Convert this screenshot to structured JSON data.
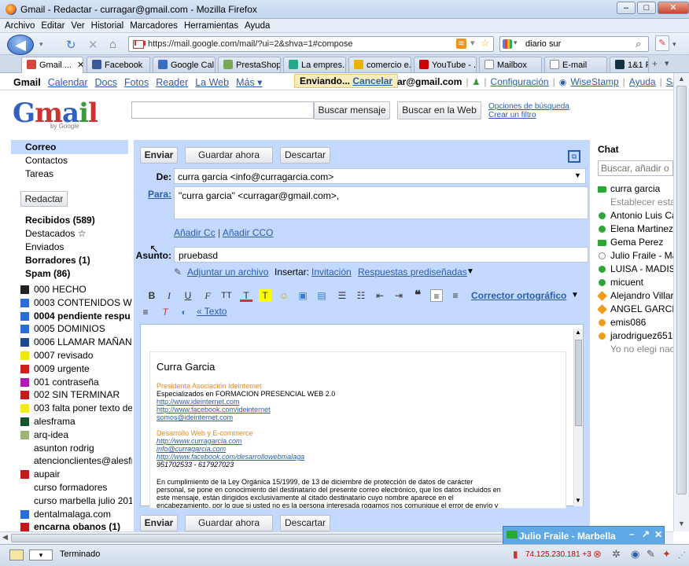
{
  "window": {
    "title": "Gmail - Redactar - curragar@gmail.com - Mozilla Firefox"
  },
  "menu": [
    "Archivo",
    "Editar",
    "Ver",
    "Historial",
    "Marcadores",
    "Herramientas",
    "Ayuda"
  ],
  "nav": {
    "url": "https://mail.google.com/mail/?ui=2&shva=1#compose",
    "search_value": "diario sur"
  },
  "tabs": [
    {
      "label": "Gmail ...",
      "color": "#d44638"
    },
    {
      "label": "Facebook",
      "color": "#3b5998"
    },
    {
      "label": "Google Cal...",
      "color": "#3a6ec4"
    },
    {
      "label": "PrestaShop...",
      "color": "#7a5"
    },
    {
      "label": "La empres...",
      "color": "#2a8"
    },
    {
      "label": "comercio e...",
      "color": "#e8b400"
    },
    {
      "label": "YouTube - ...",
      "color": "#c00"
    },
    {
      "label": "Mailbox",
      "color": "#888"
    },
    {
      "label": "E-mail",
      "color": "#888"
    },
    {
      "label": "1&1 Pa",
      "color": "#134"
    }
  ],
  "gbar": {
    "links": [
      "Gmail",
      "Calendar",
      "Docs",
      "Fotos",
      "Reader",
      "La Web",
      "Más ▾"
    ],
    "sending": "Enviando...",
    "cancel": "Cancelar",
    "account": "ar@gmail.com",
    "right_links": [
      "Configuración",
      "WiseStamp",
      "Ayuda",
      "Salir"
    ]
  },
  "search": {
    "btn_mail": "Buscar mensaje",
    "btn_web": "Buscar en la Web",
    "options": "Opciones de búsqueda",
    "filter": "Crear un filtro"
  },
  "logo": {
    "brand": "Gmail",
    "by": "by Google"
  },
  "leftnav": {
    "top": [
      "Correo",
      "Contactos",
      "Tareas"
    ],
    "compose": "Redactar",
    "folders": [
      {
        "label": "Recibidos (589)",
        "bold": true
      },
      {
        "label": "Destacados ☆",
        "bold": false
      },
      {
        "label": "Enviados",
        "bold": false
      },
      {
        "label": "Borradores (1)",
        "bold": true
      },
      {
        "label": "Spam (86)",
        "bold": true
      }
    ],
    "labels": [
      {
        "label": "000 HECHO",
        "color": "#222",
        "bold": false
      },
      {
        "label": "0003 CONTENIDOS WE",
        "color": "#2a6dd4",
        "bold": false
      },
      {
        "label": "0004 pendiente respu",
        "color": "#2a6dd4",
        "bold": true
      },
      {
        "label": "0005 DOMINIOS",
        "color": "#2a6dd4",
        "bold": false
      },
      {
        "label": "0006 LLAMAR MAÑANA",
        "color": "#1f4a8a",
        "bold": false
      },
      {
        "label": "0007 revisado",
        "color": "#f3e60a",
        "bold": false
      },
      {
        "label": "0009 urgente",
        "color": "#cc1f1f",
        "bold": false
      },
      {
        "label": "001 contraseña",
        "color": "#b418b4",
        "bold": false
      },
      {
        "label": "002 SIN TERMINAR",
        "color": "#c01c1c",
        "bold": false
      },
      {
        "label": "003 falta poner texto de",
        "color": "#f3ea1a",
        "bold": false
      },
      {
        "label": "alesframa",
        "color": "#14542a",
        "bold": false
      },
      {
        "label": "arq-idea",
        "color": "#9cb37a",
        "bold": false
      },
      {
        "label": "asunton rodrig",
        "color": "#ffffff",
        "bold": false
      },
      {
        "label": "atencionclientes@alesfr",
        "color": "#ffffff",
        "bold": false
      },
      {
        "label": "aupair",
        "color": "#c11a1a",
        "bold": false
      },
      {
        "label": "curso formadores",
        "color": "#ffffff",
        "bold": false
      },
      {
        "label": "curso marbella julio 201",
        "color": "#ffffff",
        "bold": false
      },
      {
        "label": "dentalmalaga.com",
        "color": "#2a6dd4",
        "bold": false
      },
      {
        "label": "encarna obanos (1)",
        "color": "#c11a1a",
        "bold": true
      }
    ]
  },
  "compose": {
    "send": "Enviar",
    "save": "Guardar ahora",
    "discard": "Descartar",
    "from_label": "De:",
    "from_value": "curra garcia <info@curragarcia.com>",
    "to_label": "Para:",
    "to_value": "\"curra garcia\" <curragar@gmail.com>,",
    "add_cc": "Añadir Cc",
    "add_bcc": "Añadir CCO",
    "subject_label": "Asunto:",
    "subject_value": "pruebasd",
    "attach": "Adjuntar un archivo",
    "insert": "Insertar:",
    "invite": "Invitación",
    "canned": "Respuestas prediseñadas",
    "spell": "Corrector ortográfico",
    "plain": "« Texto"
  },
  "signature": {
    "name": "Curra Garcia",
    "role": "Presidenta Asociación Ideinternet",
    "tagline": "Especializados en FORMACION PRESENCIAL WEB 2.0",
    "links1": [
      "http://www.ideinternet.com",
      "http://www.facebook.com/ideinternet",
      "somos@ideinternet.com"
    ],
    "dev": "Desarrollo Web y E-commerce",
    "links2": [
      "http://www.curragarcia.com",
      "info@curragarcia.com",
      "http://www.facebook.com/desarrollowebmalaga"
    ],
    "phones": "951702533 - 617927023",
    "legal1": "En cumplimiento de la Ley Orgánica 15/1999, de 13 de diciembre de protección de datos de carácter",
    "legal2": "personal, se pone en conocimiento del destinatario del presente correo electrónico, que los datos incluidos en",
    "legal3": "este mensaje, están dirigidos exclusivamente al citado destinatario cuyo nombre aparece en el",
    "legal4": "encabezamiento, por lo que si usted no es la persona interesada rogamos nos comunique el error de envío y"
  },
  "chat": {
    "title": "Chat",
    "search_placeholder": "Buscar, añadir o",
    "contacts": [
      {
        "name": "curra garcia",
        "color": "#2aa834",
        "status": "video"
      },
      {
        "name": "Establecer esta",
        "color": "",
        "status": "sub"
      },
      {
        "name": "Antonio Luis Ca",
        "color": "#2aa834",
        "status": "online"
      },
      {
        "name": "Elena Martinez",
        "color": "#2aa834",
        "status": "online"
      },
      {
        "name": "Gema Perez",
        "color": "#2aa834",
        "status": "video"
      },
      {
        "name": "Julio Fraile - Ma",
        "color": "#bbbbbb",
        "status": "bubble"
      },
      {
        "name": "LUISA - MADISO",
        "color": "#2aa834",
        "status": "online"
      },
      {
        "name": "micuent",
        "color": "#2aa834",
        "status": "online"
      },
      {
        "name": "Alejandro Villar",
        "color": "#f29b1a",
        "status": "mobile"
      },
      {
        "name": "ANGEL GARCIA",
        "color": "#f29b1a",
        "status": "mobile"
      },
      {
        "name": "emis086",
        "color": "#f29b1a",
        "status": "away"
      },
      {
        "name": "jarodriguez651",
        "color": "#f29b1a",
        "status": "away"
      },
      {
        "name": "Yo no elegi nac",
        "color": "",
        "status": "sub"
      }
    ]
  },
  "chatpopup": {
    "title": "Julio Fraile - Marbella"
  },
  "status": {
    "text": "Terminado",
    "ip": "74.125.230.181 +3"
  }
}
